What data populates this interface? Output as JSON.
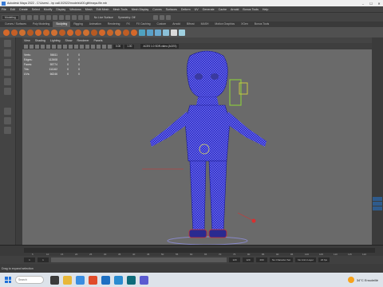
{
  "window": {
    "title": "Autodesk Maya 2022 - C:\\Users\\...\\rp ca8.0/2022/models\\400.gltf/maya-file.mb"
  },
  "menu": [
    "File",
    "Edit",
    "Create",
    "Select",
    "Modify",
    "Display",
    "Windows",
    "Mesh",
    "Edit Mesh",
    "Mesh Tools",
    "Mesh Display",
    "Curves",
    "Surfaces",
    "Deform",
    "UV",
    "Generate",
    "Cache",
    "Arnold",
    "Bonus Tools",
    "Help"
  ],
  "statusline": {
    "mode": "Modeling",
    "surface_label": "No Live Surface",
    "symmetry_label": "Symmetry: Off"
  },
  "shelf_tabs": {
    "items": [
      "Curves / Surfaces",
      "Poly Modeling",
      "Sculpting",
      "Rigging",
      "Animation",
      "Rendering",
      "FX",
      "FX Caching",
      "Custom",
      "Arnold",
      "Bifrost",
      "MASH",
      "Motion Graphics",
      "XGen",
      "Bonus Tools"
    ],
    "active_index": 2
  },
  "viewport_menu": [
    "View",
    "Shading",
    "Lighting",
    "Show",
    "Renderer",
    "Panels"
  ],
  "viewport_toolbar": {
    "field_a": "0.00",
    "field_b": "1.00",
    "colorspace": "ACES 1.0 SDR-video (ACES)"
  },
  "hud": {
    "rows": [
      {
        "label": "Verts:",
        "value": "56611",
        "c1": "0",
        "c2": "0"
      },
      {
        "label": "Edges:",
        "value": "112608",
        "c1": "0",
        "c2": "0"
      },
      {
        "label": "Faces:",
        "value": "55774",
        "c1": "0",
        "c2": "0"
      },
      {
        "label": "Tris:",
        "value": "111162",
        "c1": "0",
        "c2": "0"
      },
      {
        "label": "UVs:",
        "value": "66246",
        "c1": "0",
        "c2": "0"
      }
    ]
  },
  "time_ticks": [
    "5",
    "10",
    "15",
    "20",
    "25",
    "30",
    "35",
    "40",
    "45",
    "50",
    "55",
    "60",
    "65",
    "70",
    "75",
    "80",
    "85",
    "90",
    "95",
    "100",
    "105",
    "110",
    "115",
    "120"
  ],
  "range": {
    "start": "1",
    "start2": "1",
    "end": "120",
    "end2": "120",
    "end3": "200",
    "character_set": "No Character Set",
    "anim_layer": "No Anim Layer",
    "fps": "24 fps"
  },
  "helpline": "Drag to expand selection",
  "taskbar": {
    "search": "Search",
    "weather": "34°C  Ensoleillé"
  },
  "colors": {
    "viewport": "#6a6a6a",
    "wire": "#2b2bd8",
    "accent": "#5d5d5d",
    "taskbar": "#dde3ea"
  }
}
